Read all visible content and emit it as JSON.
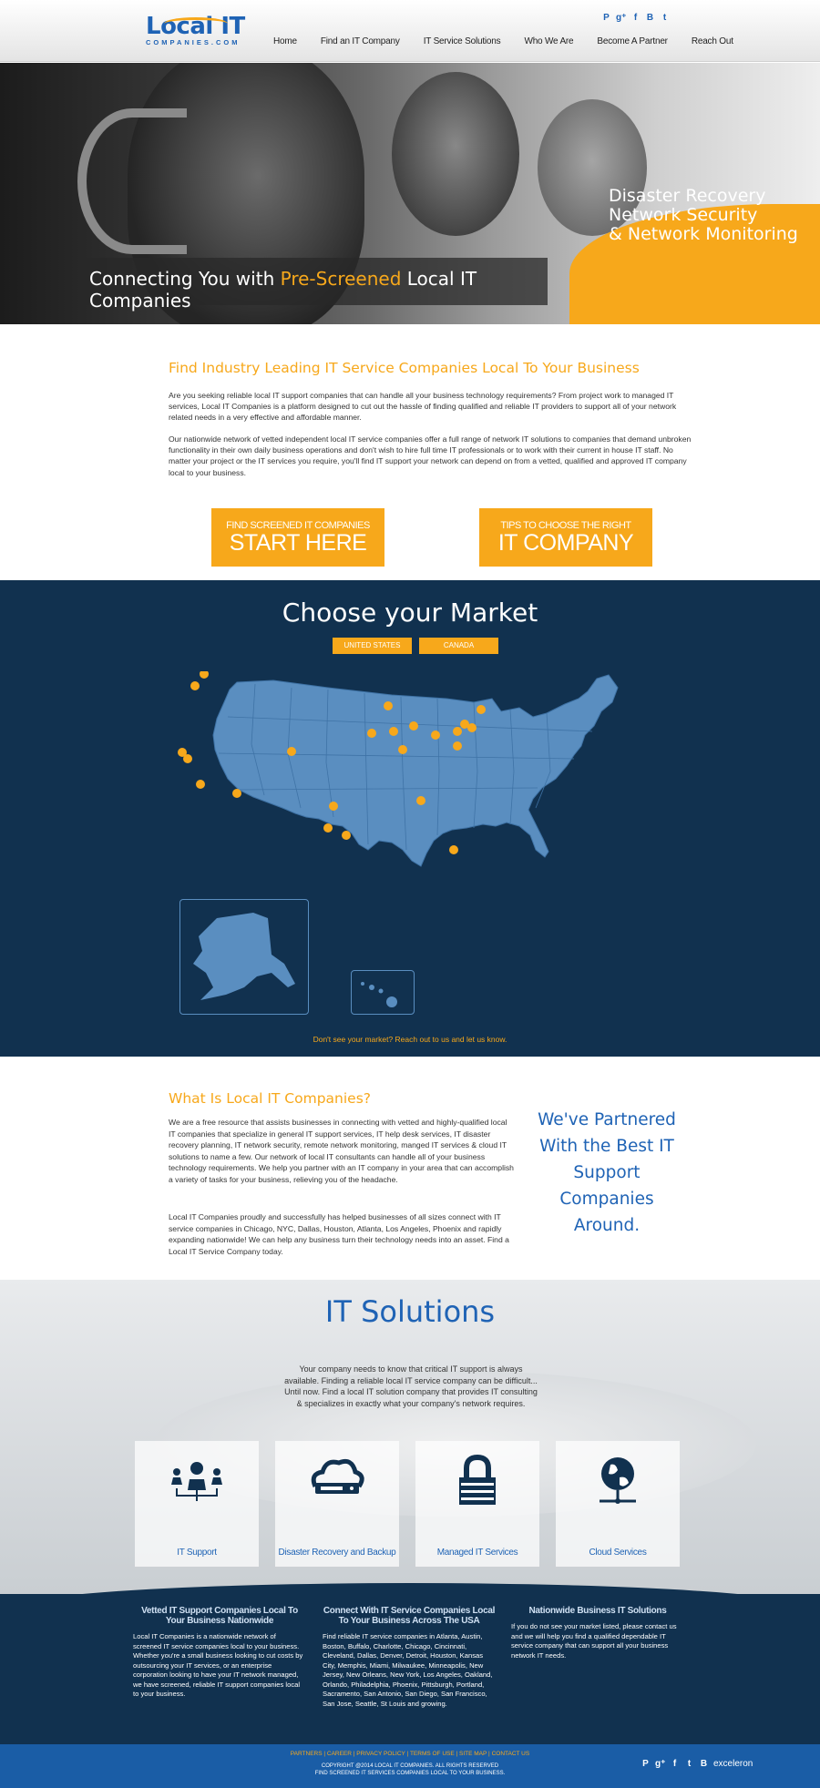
{
  "brand": {
    "name_main": "Local",
    "name_it": "IT",
    "sub": "COMPANIES.COM"
  },
  "nav": [
    "Home",
    "Find an IT Company",
    "IT Service Solutions",
    "Who We Are",
    "Become A Partner",
    "Reach Out"
  ],
  "social_icons": [
    "pinterest-icon",
    "google-plus-icon",
    "facebook-icon",
    "blogger-icon",
    "tumblr-icon"
  ],
  "hero": {
    "caption_pre": "Connecting You with ",
    "caption_highlight": "Pre-Screened",
    "caption_post": " Local IT Companies",
    "services": [
      "Disaster Recovery",
      "Network Security",
      "& Network Monitoring"
    ]
  },
  "intro": {
    "title": "Find Industry Leading IT Service Companies Local To Your Business",
    "p1": "Are you seeking reliable local IT support companies that can handle all your business technology requirements? From project work to managed IT services, Local IT Companies is a platform designed to cut out the hassle of finding qualified and reliable IT providers to support all of your network related needs in a very effective and affordable manner.",
    "p2": "Our nationwide network of vetted independent local IT service companies offer a full range of network IT solutions to companies that demand unbroken functionality in their own daily business operations and don't wish to hire full time IT professionals or to work with their current in house IT staff. No matter your project or the IT services you require, you'll find IT support your network can depend on from a vetted, qualified and approved IT company local to your business.",
    "cta1_small": "FIND SCREENED IT COMPANIES",
    "cta1_large": "START HERE",
    "cta2_small": "TIPS TO CHOOSE THE RIGHT",
    "cta2_large": "IT COMPANY"
  },
  "market": {
    "title": "Choose your Market",
    "btn_us": "UNITED STATES",
    "btn_canada": "CANADA",
    "note": "Don't see your market? Reach out to us and let us know."
  },
  "about": {
    "title": "What Is Local IT Companies?",
    "p1": "We are a free resource that assists businesses in connecting with vetted and highly-qualified local IT companies that specialize in general IT support services, IT help desk services, IT disaster recovery planning, IT network security, remote network monitoring, manged IT services & cloud IT solutions to name a few. Our network of local IT consultants can handle all of your business technology requirements. We help you partner with an IT company in your area that can accomplish a variety of tasks for your business, relieving you of the headache.",
    "p2": "Local IT Companies proudly and successfully has helped businesses of all sizes connect with IT service companies in Chicago, NYC, Dallas, Houston, Atlanta, Los Angeles, Phoenix and rapidly expanding nationwide! We can help any business turn their technology needs into an asset. Find a Local IT Service Company today.",
    "partner": "We've Partnered With the Best IT Support Companies Around."
  },
  "solutions": {
    "title": "IT Solutions",
    "text": "Your company needs to know that critical IT support is always available. Finding a reliable local IT service company can be difficult... Until now. Find a local IT solution company that provides IT consulting & specializes in exactly what your company's network requires.",
    "cards": [
      {
        "label": "IT Support",
        "icon": "people-network-icon"
      },
      {
        "label": "Disaster Recovery and Backup",
        "icon": "cloud-server-icon"
      },
      {
        "label": "Managed IT Services",
        "icon": "padlock-icon"
      },
      {
        "label": "Cloud Services",
        "icon": "globe-network-icon"
      }
    ]
  },
  "footer": {
    "col1_title": "Vetted IT Support Companies Local To Your Business Nationwide",
    "col1_text": "Local IT Companies is a nationwide network of screened IT service companies local to your business. Whether you're a small business looking to cut costs by outsourcing your IT services, or an enterprise corporation looking to have your IT network managed, we have screened, reliable IT support companies local to your business.",
    "col2_title": "Connect With IT Service Companies Local To Your Business Across The USA",
    "col2_text": "Find reliable IT service companies in Atlanta, Austin, Boston, Buffalo, Charlotte, Chicago, Cincinnati, Cleveland, Dallas, Denver, Detroit, Houston, Kansas City, Memphis, Miami, Milwaukee, Minneapolis, New Jersey, New Orleans, New York, Los Angeles, Oakland, Orlando, Philadelphia, Phoenix, Pittsburgh, Portland, Sacramento, San Antonio, San Diego, San Francisco, San Jose, Seattle, St Louis and growing.",
    "col3_title": "Nationwide Business IT Solutions",
    "col3_text": "If you do not see your market listed, please contact us and we will help you find a qualified dependable IT service company that can support all your business network IT needs.",
    "links": [
      "PARTNERS",
      "CAREER",
      "PRIVACY POLICY",
      "TERMS OF USE",
      "SITE MAP",
      "CONTACT US"
    ],
    "copy1": "COPYRIGHT @2014 LOCAL IT COMPANIES. ALL RIGHTS RESERVED",
    "copy2": "FIND SCREENED IT SERVICES COMPANIES LOCAL TO YOUR BUSINESS.",
    "credit": "exceleron"
  },
  "colors": {
    "accent": "#f7a81b",
    "brand_blue": "#1f63b5",
    "navy": "#11314f",
    "footer_blue": "#1a5da6"
  }
}
